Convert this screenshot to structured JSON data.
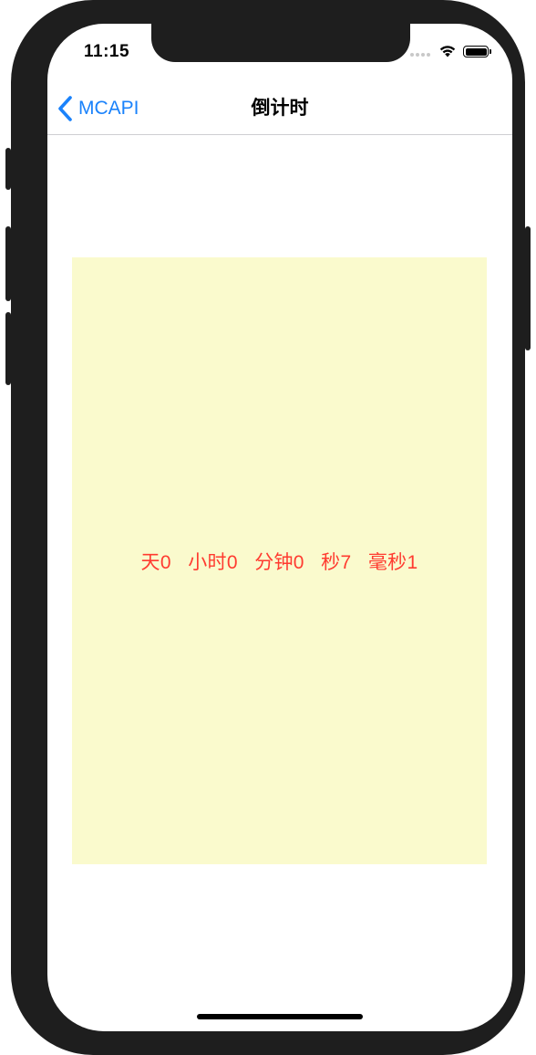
{
  "status_bar": {
    "time": "11:15"
  },
  "navbar": {
    "back_label": "MCAPI",
    "title": "倒计时"
  },
  "countdown": {
    "text": "天0   小时0   分钟0   秒7   毫秒1"
  },
  "colors": {
    "accent": "#1a82fb",
    "countdown_text": "#ff3b30",
    "panel_background": "#fafacd",
    "device_frame": "#1e1e1e"
  },
  "icons": {
    "back": "chevron-left-icon",
    "wifi": "wifi-icon",
    "battery": "battery-icon",
    "signal": "signal-icon"
  }
}
